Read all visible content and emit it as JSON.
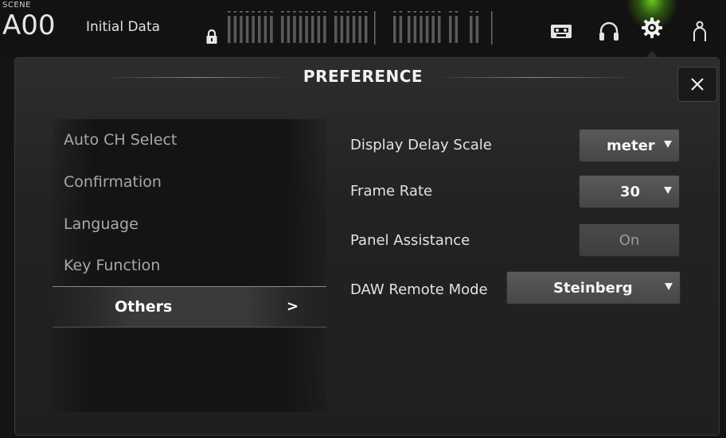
{
  "header": {
    "scene_label": "SCENE",
    "scene_number": "A00",
    "scene_title": "Initial Data",
    "icons": [
      "lock-icon",
      "recorder-icon",
      "headphones-icon",
      "gear-icon",
      "user-icon"
    ],
    "active_color": "#7ad62a"
  },
  "dialog": {
    "title": "PREFERENCE",
    "close_label": "×"
  },
  "menu": {
    "items": [
      {
        "label": "Auto CH Select"
      },
      {
        "label": "Confirmation"
      },
      {
        "label": "Language"
      },
      {
        "label": "Key Function"
      }
    ],
    "active": {
      "label": "Others",
      "arrow": ">"
    }
  },
  "settings": {
    "display_delay_scale": {
      "label": "Display Delay Scale",
      "value": "meter"
    },
    "frame_rate": {
      "label": "Frame Rate",
      "value": "30"
    },
    "panel_assistance": {
      "label": "Panel Assistance",
      "value": "On"
    },
    "daw_remote_mode": {
      "label": "DAW Remote Mode",
      "value": "Steinberg"
    }
  }
}
